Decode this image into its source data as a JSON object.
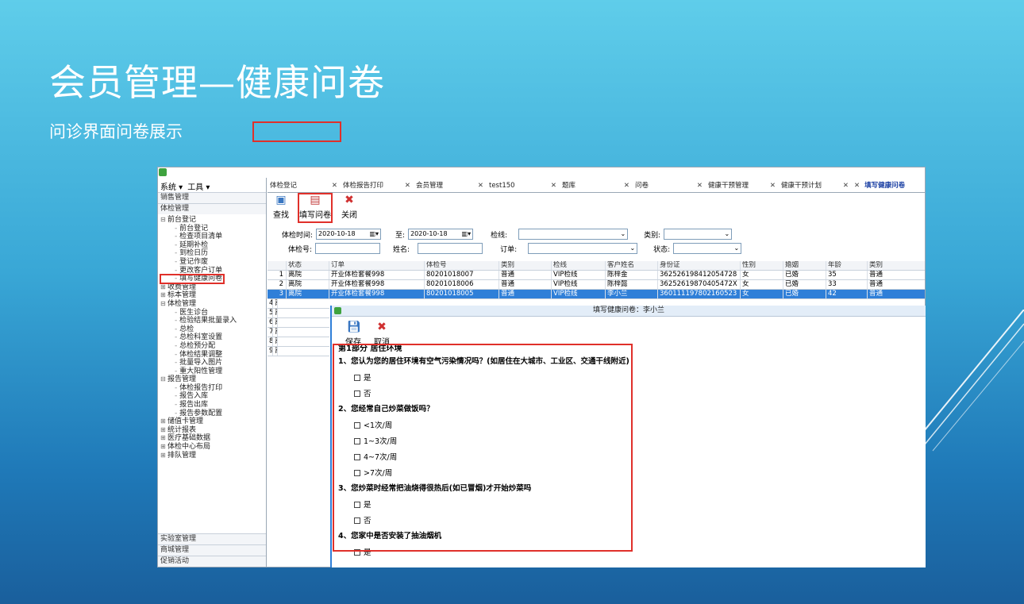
{
  "slide": {
    "title": "会员管理—健康问卷",
    "subtitle": "问诊界面问卷展示"
  },
  "menubar": {
    "system": "系统 ▾",
    "tools": "工具 ▾"
  },
  "sidebar": {
    "sections_top": [
      "销售管理",
      "体检管理"
    ],
    "tree": [
      {
        "level": 1,
        "pm": "⊟",
        "label": "前台登记"
      },
      {
        "level": 2,
        "label": "前台登记"
      },
      {
        "level": 2,
        "label": "检查项目清单"
      },
      {
        "level": 2,
        "label": "延期补检"
      },
      {
        "level": 2,
        "label": "到检日历"
      },
      {
        "level": 2,
        "label": "登记作废"
      },
      {
        "level": 2,
        "label": "更改客户订单"
      },
      {
        "level": 2,
        "label": "填写健康问卷",
        "highlight": true
      },
      {
        "level": 1,
        "pm": "⊞",
        "label": "收费管理"
      },
      {
        "level": 1,
        "pm": "⊞",
        "label": "标本管理"
      },
      {
        "level": 1,
        "pm": "⊟",
        "label": "体检管理"
      },
      {
        "level": 2,
        "label": "医生诊台"
      },
      {
        "level": 2,
        "label": "检验结果批量录入"
      },
      {
        "level": 2,
        "label": "总检"
      },
      {
        "level": 2,
        "label": "总检科室设置"
      },
      {
        "level": 2,
        "label": "总检预分配"
      },
      {
        "level": 2,
        "label": "体检结果调整"
      },
      {
        "level": 2,
        "label": "批量导入图片"
      },
      {
        "level": 2,
        "label": "重大阳性管理"
      },
      {
        "level": 1,
        "pm": "⊟",
        "label": "报告管理"
      },
      {
        "level": 2,
        "label": "体检报告打印"
      },
      {
        "level": 2,
        "label": "报告入库"
      },
      {
        "level": 2,
        "label": "报告出库"
      },
      {
        "level": 2,
        "label": "报告参数配置"
      },
      {
        "level": 1,
        "pm": "⊞",
        "label": "储值卡管理"
      },
      {
        "level": 1,
        "pm": "⊞",
        "label": "统计报表"
      },
      {
        "level": 1,
        "pm": "⊞",
        "label": "医疗基础数据"
      },
      {
        "level": 1,
        "pm": "⊞",
        "label": "体检中心布局"
      },
      {
        "level": 1,
        "pm": "⊞",
        "label": "排队管理"
      }
    ],
    "sections_bottom": [
      "实验室管理",
      "商城管理",
      "促销活动"
    ]
  },
  "tabs": [
    {
      "label": "体检登记",
      "active": false
    },
    {
      "label": "体检报告打印",
      "active": false
    },
    {
      "label": "会员管理",
      "active": false
    },
    {
      "label": "test150",
      "active": false
    },
    {
      "label": "题库",
      "active": false
    },
    {
      "label": "问卷",
      "active": false
    },
    {
      "label": "健康干预管理",
      "active": false
    },
    {
      "label": "健康干预计划",
      "active": false
    },
    {
      "label": "填写健康问卷",
      "active": true
    }
  ],
  "toolbar": {
    "search": "查找",
    "fill": "填写问卷",
    "close": "关闭"
  },
  "form": {
    "exam_time_label": "体检时间:",
    "date_from": "2020-10-18",
    "to_label": "至:",
    "date_to": "2020-10-18",
    "package_label": "检线:",
    "package_value": "",
    "category_label": "类别:",
    "category_value": "",
    "exam_no_label": "体检号:",
    "exam_no_value": "",
    "name_label": "姓名:",
    "name_value": "",
    "order_label": "订单:",
    "order_value": "",
    "status_label": "状态:",
    "status_value": ""
  },
  "grid": {
    "headers": [
      "",
      "状态",
      "订单",
      "体检号",
      "类别",
      "检线",
      "客户姓名",
      "身份证",
      "性别",
      "婚姻",
      "年龄",
      "类别"
    ],
    "rows": [
      [
        "1",
        "离院",
        "开业体检套餐998",
        "80201018007",
        "普通",
        "VIP检线",
        "陈梓金",
        "362526198412054728",
        "女",
        "已婚",
        "35",
        "普通"
      ],
      [
        "2",
        "离院",
        "开业体检套餐998",
        "80201018006",
        "普通",
        "VIP检线",
        "陈梓懿",
        "36252619870405472X",
        "女",
        "已婚",
        "33",
        "普通"
      ],
      [
        "3",
        "离院",
        "开业体检套餐998",
        "80201018005",
        "普通",
        "VIP检线",
        "李小兰",
        "360111197802160523",
        "女",
        "已婚",
        "42",
        "普通"
      ],
      [
        "4",
        "离院"
      ],
      [
        "5",
        "离院"
      ],
      [
        "6",
        "离院"
      ],
      [
        "7",
        "离院"
      ],
      [
        "8",
        "离院"
      ],
      [
        "9",
        "离院"
      ]
    ],
    "selected_row": 2
  },
  "dialog": {
    "title": "填写健康问卷：李小兰",
    "save": "保存",
    "cancel": "取消",
    "part": "第1部分  居住环境",
    "questions": [
      {
        "title": "1、您认为您的居住环境有空气污染情况吗？(如居住在大城市、工业区、交通干线附近)",
        "options": [
          "是",
          "否"
        ]
      },
      {
        "title": "2、您经常自己炒菜做饭吗？",
        "options": [
          "<1次/周",
          "1~3次/周",
          "4~7次/周",
          ">7次/周"
        ]
      },
      {
        "title": "3、您炒菜时经常把油烧得很热后(如已冒烟)才开始炒菜吗",
        "options": [
          "是",
          "否"
        ]
      },
      {
        "title": "4、您家中是否安装了抽油烟机",
        "options": [
          "是"
        ]
      }
    ]
  }
}
